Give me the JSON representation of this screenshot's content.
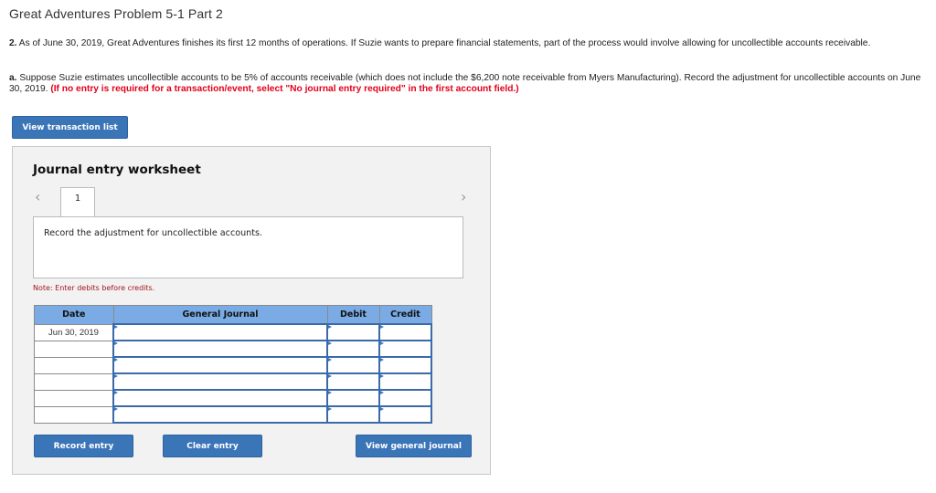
{
  "page": {
    "title": "Great Adventures Problem 5-1 Part 2"
  },
  "question": {
    "p1_number": "2.",
    "p1_text": " As of June 30, 2019, Great Adventures finishes its first 12 months of operations. If Suzie wants to prepare financial statements, part of the process would involve allowing for uncollectible accounts receivable.",
    "p2_letter": "a.",
    "p2_text": " Suppose Suzie estimates uncollectible accounts to be 5% of accounts receivable (which does not include the $6,200 note receivable from Myers Manufacturing). Record the adjustment for uncollectible accounts on June 30, 2019. ",
    "p2_instruction": "(If no entry is required for a transaction/event, select \"No journal entry required\" in the first account field.)"
  },
  "buttons": {
    "view_transaction_list": "View transaction list",
    "record_entry": "Record entry",
    "clear_entry": "Clear entry",
    "view_general_journal": "View general journal"
  },
  "worksheet": {
    "title": "Journal entry worksheet",
    "prev_icon": "chevron-left-icon",
    "next_icon": "chevron-right-icon",
    "prev_glyph": "‹",
    "next_glyph": "›",
    "active_tab": "1",
    "instruction": "Record the adjustment for uncollectible accounts.",
    "note": "Note: Enter debits before credits.",
    "columns": [
      "Date",
      "General Journal",
      "Debit",
      "Credit"
    ],
    "rows": [
      {
        "date": "Jun 30, 2019",
        "account": "",
        "debit": "",
        "credit": ""
      },
      {
        "date": "",
        "account": "",
        "debit": "",
        "credit": ""
      },
      {
        "date": "",
        "account": "",
        "debit": "",
        "credit": ""
      },
      {
        "date": "",
        "account": "",
        "debit": "",
        "credit": ""
      },
      {
        "date": "",
        "account": "",
        "debit": "",
        "credit": ""
      },
      {
        "date": "",
        "account": "",
        "debit": "",
        "credit": ""
      }
    ]
  },
  "colors": {
    "button_bg": "#3a75b8",
    "header_bg": "#7aabe4",
    "instruction_red": "#e2001a",
    "note_red": "#a4151c"
  }
}
